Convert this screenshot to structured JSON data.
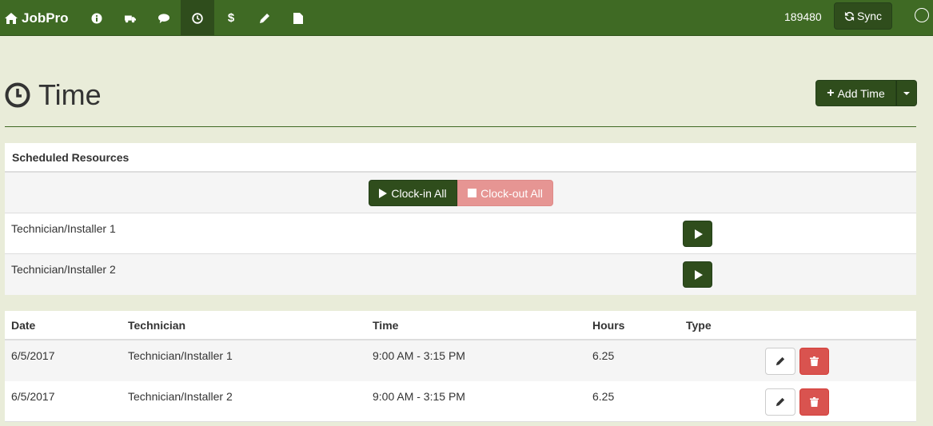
{
  "navbar": {
    "brand": "JobPro",
    "icons": [
      {
        "name": "info-icon",
        "glyph": "info"
      },
      {
        "name": "truck-icon",
        "glyph": "truck"
      },
      {
        "name": "comment-icon",
        "glyph": "comment"
      },
      {
        "name": "clock-icon",
        "glyph": "clock",
        "active": true
      },
      {
        "name": "dollar-icon",
        "glyph": "$"
      },
      {
        "name": "pencil-icon",
        "glyph": "pencil"
      },
      {
        "name": "file-icon",
        "glyph": "file"
      }
    ],
    "job_number": "189480",
    "sync_label": "Sync",
    "accent_color": "#3f6a24"
  },
  "header": {
    "title": "Time",
    "add_button_label": "Add Time"
  },
  "scheduled": {
    "title": "Scheduled Resources",
    "clock_in_all_label": "Clock-in All",
    "clock_out_all_label": "Clock-out All",
    "resources": [
      {
        "name": "Technician/Installer 1"
      },
      {
        "name": "Technician/Installer 2"
      }
    ]
  },
  "time_table": {
    "columns": [
      "Date",
      "Technician",
      "Time",
      "Hours",
      "Type"
    ],
    "rows": [
      {
        "date": "6/5/2017",
        "technician": "Technician/Installer 1",
        "time": "9:00 AM - 3:15 PM",
        "hours": "6.25",
        "type": ""
      },
      {
        "date": "6/5/2017",
        "technician": "Technician/Installer 2",
        "time": "9:00 AM - 3:15 PM",
        "hours": "6.25",
        "type": ""
      }
    ]
  },
  "colors": {
    "primary": "#2f4d1c",
    "danger": "#d9534f",
    "disabled_danger": "#e69593",
    "background": "#e9ecd9"
  }
}
